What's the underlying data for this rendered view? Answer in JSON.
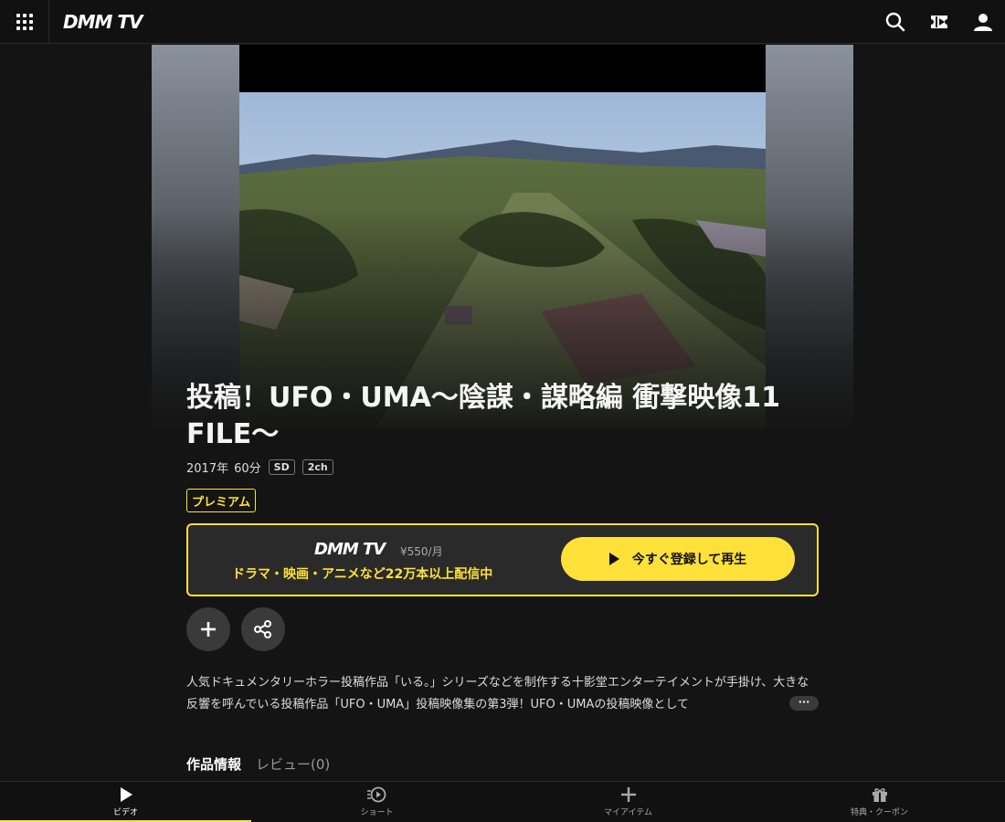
{
  "header": {
    "logo": "DMM TV",
    "icons": [
      "apps-grid-icon",
      "search-icon",
      "ticket-icon",
      "user-icon"
    ]
  },
  "title": "投稿！UFO・UMA～陰謀・謀略編 衝撃映像11 FILE～",
  "meta": {
    "year": "2017年",
    "duration": "60分",
    "quality": "SD",
    "audio": "2ch"
  },
  "premium_badge": "プレミアム",
  "cta": {
    "logo": "DMM TV",
    "price": "¥550/月",
    "subtitle": "ドラマ・映画・アニメなど22万本以上配信中",
    "button": "今すぐ登録して再生"
  },
  "description": "人気ドキュメンタリーホラー投稿作品「いる。」シリーズなどを制作する十影堂エンターテイメントが手掛け、大きな反響を呼んでいる投稿作品「UFO・UMA」投稿映像集の第3弾！UFO・UMAの投稿映像として",
  "more_label": "···",
  "tabs": [
    "作品情報",
    "レビュー(0)"
  ],
  "bottom_nav": [
    {
      "label": "ビデオ",
      "icon": "play-icon"
    },
    {
      "label": "ショート",
      "icon": "short-play-icon"
    },
    {
      "label": "マイアイテム",
      "icon": "plus-icon"
    },
    {
      "label": "特典・クーポン",
      "icon": "gift-icon"
    }
  ],
  "colors": {
    "accent": "#ffe13a",
    "background": "#141414"
  }
}
